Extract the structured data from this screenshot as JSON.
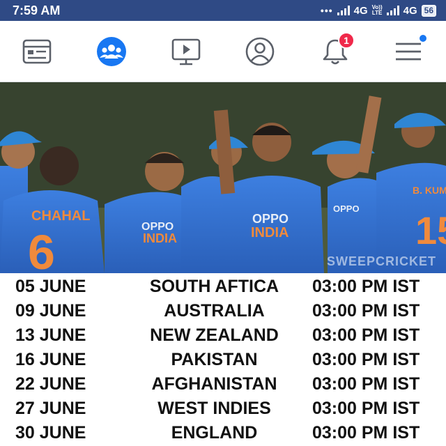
{
  "status_bar": {
    "time": "7:59 AM",
    "dots": "•••",
    "network_1": "4G",
    "volte_line1": "Vo))",
    "volte_line2": "LTE",
    "network_2": "4G",
    "battery": "56"
  },
  "nav": {
    "items": [
      {
        "name": "news-feed",
        "icon": "news-feed-icon",
        "active": false
      },
      {
        "name": "groups",
        "icon": "groups-icon",
        "active": true
      },
      {
        "name": "watch",
        "icon": "video-icon",
        "active": false
      },
      {
        "name": "profile",
        "icon": "profile-icon",
        "active": false
      },
      {
        "name": "notifications",
        "icon": "bell-icon",
        "active": false,
        "badge": "1"
      },
      {
        "name": "menu",
        "icon": "hamburger-menu-icon",
        "active": false
      }
    ],
    "accent_color": "#1877f2",
    "badge_color": "#f0284a"
  },
  "photo": {
    "jersey_texts": [
      "CHAHAL",
      "6",
      "OPPO",
      "INDIA",
      "OPPO",
      "INDIA",
      "OPPO",
      "B. KUMAR",
      "15"
    ],
    "watermark": "SWEEPCRICKET"
  },
  "schedule": [
    {
      "date": "05 JUNE",
      "opponent": "SOUTH AFTICA",
      "time": "03:00 PM IST"
    },
    {
      "date": "09 JUNE",
      "opponent": "AUSTRALIA",
      "time": "03:00 PM IST"
    },
    {
      "date": "13 JUNE",
      "opponent": "NEW ZEALAND",
      "time": "03:00 PM IST"
    },
    {
      "date": "16 JUNE",
      "opponent": "PAKISTAN",
      "time": "03:00 PM IST"
    },
    {
      "date": "22 JUNE",
      "opponent": "AFGHANISTAN",
      "time": "03:00 PM IST"
    },
    {
      "date": "27 JUNE",
      "opponent": "WEST INDIES",
      "time": "03:00 PM IST"
    },
    {
      "date": "30 JUNE",
      "opponent": "ENGLAND",
      "time": "03:00 PM IST"
    }
  ]
}
